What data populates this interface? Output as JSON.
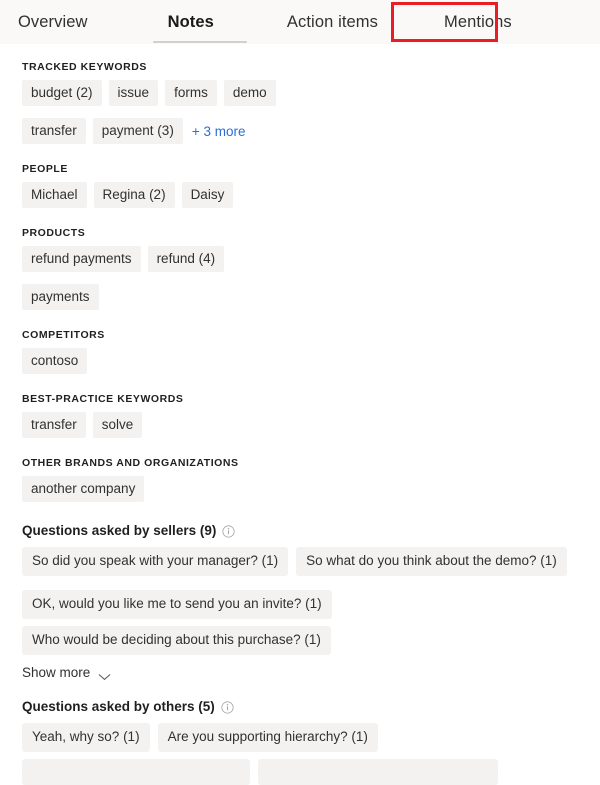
{
  "tabs": [
    {
      "label": "Overview",
      "selected": false
    },
    {
      "label": "Notes",
      "selected": true
    },
    {
      "label": "Action items",
      "selected": false
    },
    {
      "label": "Mentions",
      "selected": false,
      "annotated": true
    }
  ],
  "annotation": {
    "color": "#ec1c24",
    "target": "Mentions"
  },
  "colors": {
    "chip_bg": "#f3f2f1",
    "link": "#2b6fd4",
    "text": "#323130",
    "header_bg": "#faf9f8",
    "tab_underline": "#d2d0ce"
  },
  "sections": [
    {
      "title": "TRACKED KEYWORDS",
      "chips": [
        "budget (2)",
        "issue",
        "forms",
        "demo",
        "transfer",
        "payment (3)"
      ],
      "more_label": "+ 3 more"
    },
    {
      "title": "PEOPLE",
      "chips": [
        "Michael",
        "Regina (2)",
        "Daisy"
      ]
    },
    {
      "title": "PRODUCTS",
      "chips": [
        "refund payments",
        "refund (4)",
        "payments"
      ]
    },
    {
      "title": "COMPETITORS",
      "chips": [
        "contoso"
      ]
    },
    {
      "title": "BEST-PRACTICE KEYWORDS",
      "chips": [
        "transfer",
        "solve"
      ]
    },
    {
      "title": "OTHER BRANDS AND ORGANIZATIONS",
      "chips": [
        "another company"
      ]
    }
  ],
  "questions_sellers": {
    "heading": "Questions asked by sellers (9)",
    "info_icon": "info-icon",
    "chips": [
      "So did you speak with your manager? (1)",
      "So what do you think about the demo? (1)",
      "OK, would you like me to send you an invite? (1)",
      "Who would be deciding about this purchase? (1)"
    ],
    "show_more_label": "Show more",
    "chevron_icon": "chevron-down-icon"
  },
  "questions_others": {
    "heading": "Questions asked by others (5)",
    "info_icon": "info-icon",
    "chips": [
      "Yeah, why so? (1)",
      "Are you supporting hierarchy? (1)"
    ]
  }
}
